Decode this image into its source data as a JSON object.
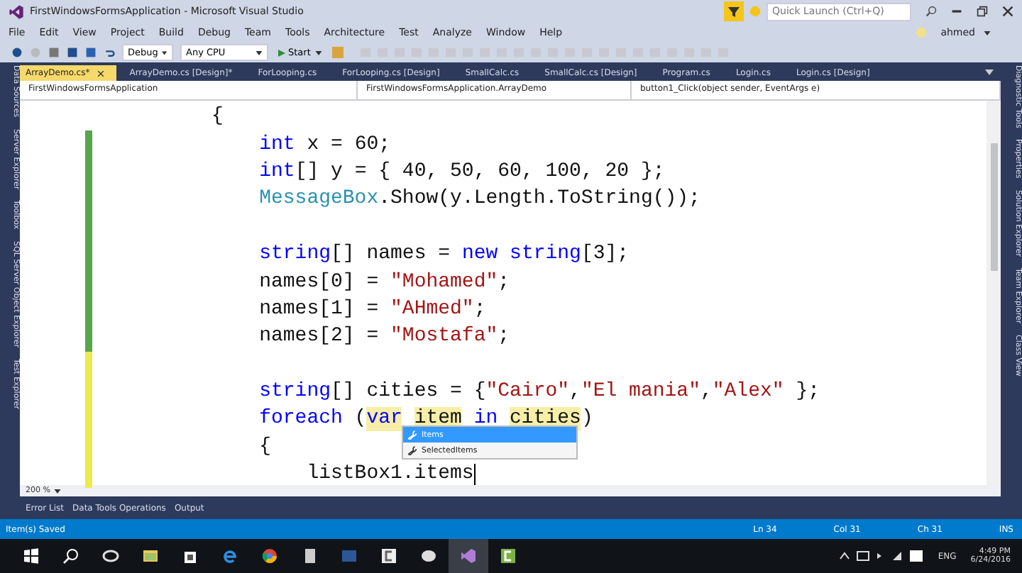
{
  "window": {
    "title": "FirstWindowsFormsApplication - Microsoft Visual Studio",
    "quick_launch": {
      "placeholder": "Quick Launch (Ctrl+Q)"
    },
    "user": "ahmed"
  },
  "menu": [
    "File",
    "Edit",
    "View",
    "Project",
    "Build",
    "Debug",
    "Team",
    "Tools",
    "Architecture",
    "Test",
    "Analyze",
    "Window",
    "Help"
  ],
  "toolbar": {
    "configuration": "Debug",
    "platform": "Any CPU",
    "start": "Start"
  },
  "left_tool_windows": [
    "Data Sources",
    "Server Explorer",
    "Toolbox",
    "SQL Server Object Explorer",
    "Test Explorer"
  ],
  "right_tool_windows": [
    "Diagnostic Tools",
    "Properties",
    "Solution Explorer",
    "Team Explorer",
    "Class View"
  ],
  "tabs": [
    {
      "label": "ArrayDemo.cs*",
      "selected": true
    },
    {
      "label": "ArrayDemo.cs [Design]*",
      "selected": false
    },
    {
      "label": "ForLooping.cs",
      "selected": false
    },
    {
      "label": "ForLooping.cs [Design]",
      "selected": false
    },
    {
      "label": "SmallCalc.cs",
      "selected": false
    },
    {
      "label": "SmallCalc.cs [Design]",
      "selected": false
    },
    {
      "label": "Program.cs",
      "selected": false
    },
    {
      "label": "Login.cs",
      "selected": false
    },
    {
      "label": "Login.cs [Design]",
      "selected": false
    }
  ],
  "navigation": [
    "FirstWindowsFormsApplication",
    "FirstWindowsFormsApplication.ArrayDemo",
    "button1_Click(object sender, EventArgs e)"
  ],
  "code": [
    {
      "changed": false,
      "tokens": [
        {
          "kind": "plain",
          "text": "{"
        }
      ],
      "children": [
        {
          "changed": true,
          "saved": true,
          "tokens": [
            {
              "kind": "keyword",
              "text": "int"
            },
            {
              "kind": "plain",
              "text": " x = 60;"
            }
          ]
        },
        {
          "changed": true,
          "saved": true,
          "tokens": [
            {
              "kind": "keyword",
              "text": "int"
            },
            {
              "kind": "plain",
              "text": "[] y = { 40, 50, 60, 100, 20 };"
            }
          ]
        },
        {
          "changed": true,
          "saved": true,
          "tokens": [
            {
              "kind": "type",
              "text": "MessageBox"
            },
            {
              "kind": "plain",
              "text": ".Show(y.Length.ToString());"
            }
          ]
        },
        {
          "changed": true,
          "saved": true
        },
        {
          "changed": true,
          "saved": true,
          "tokens": [
            {
              "kind": "keyword",
              "text": "string"
            },
            {
              "kind": "plain",
              "text": "[] names = "
            },
            {
              "kind": "keyword",
              "text": "new"
            },
            {
              "kind": "keyword",
              "text": "string",
              "space_before": true
            },
            {
              "kind": "plain",
              "text": "[3];"
            }
          ]
        },
        {
          "changed": true,
          "saved": true,
          "tokens": [
            {
              "kind": "plain",
              "text": "names[0] = "
            },
            {
              "kind": "string",
              "text": "\"Mohamed\""
            },
            {
              "kind": "plain",
              "text": ";"
            }
          ]
        },
        {
          "changed": true,
          "saved": true,
          "tokens": [
            {
              "kind": "plain",
              "text": "names[1] = "
            },
            {
              "kind": "string",
              "text": "\"AHmed\""
            },
            {
              "kind": "plain",
              "text": ";"
            }
          ]
        },
        {
          "changed": true,
          "saved": true,
          "tokens": [
            {
              "kind": "plain",
              "text": "names[2] = "
            },
            {
              "kind": "string",
              "text": "\"Mostafa\""
            },
            {
              "kind": "plain",
              "text": ";"
            }
          ]
        },
        {
          "changed": true,
          "saved": false
        },
        {
          "changed": true,
          "saved": false,
          "tokens": [
            {
              "kind": "keyword",
              "text": "string"
            },
            {
              "kind": "plain",
              "text": "[] cities = {"
            },
            {
              "kind": "string",
              "text": "\"Cairo\""
            },
            {
              "kind": "plain",
              "text": ","
            },
            {
              "kind": "string",
              "text": "\"El mania\""
            },
            {
              "kind": "plain",
              "text": ","
            },
            {
              "kind": "string",
              "text": "\"Alex\""
            },
            {
              "kind": "plain",
              "text": " };"
            }
          ]
        },
        {
          "changed": true,
          "saved": false,
          "tokens": [
            {
              "kind": "keyword",
              "text": "foreach"
            },
            {
              "kind": "plain",
              "text": " ("
            },
            {
              "kind": "keyword",
              "text": "var",
              "highlighted": true
            },
            {
              "kind": "plain",
              "text": "item",
              "highlighted": true,
              "space_before": true
            },
            {
              "kind": "keyword",
              "text": "in",
              "space_before": true
            },
            {
              "kind": "plain",
              "text": "cities",
              "highlighted": true,
              "space_before": true
            },
            {
              "kind": "plain",
              "text": ")"
            }
          ]
        },
        {
          "changed": true,
          "saved": false,
          "tokens": [
            {
              "kind": "plain",
              "text": "{"
            }
          ],
          "children": [
            {
              "changed": true,
              "saved": false,
              "cursor": true,
              "tokens": [
                {
                  "kind": "plain",
                  "text": "listBox1.items"
                }
              ]
            }
          ]
        }
      ]
    }
  ],
  "completion": [
    {
      "label": "Items",
      "selected": true
    },
    {
      "label": "SelectedItems",
      "selected": false
    }
  ],
  "zoom": "200 %",
  "bottom_tabs": [
    "Error List",
    "Data Tools Operations",
    "Output"
  ],
  "status_bar": {
    "message": "Item(s) Saved",
    "line": "Ln 34",
    "column": "Col 31",
    "char": "Ch 31",
    "mode": "INS"
  },
  "taskbar": {
    "language": "ENG",
    "time": "4:49 PM",
    "date": "6/24/2016"
  }
}
